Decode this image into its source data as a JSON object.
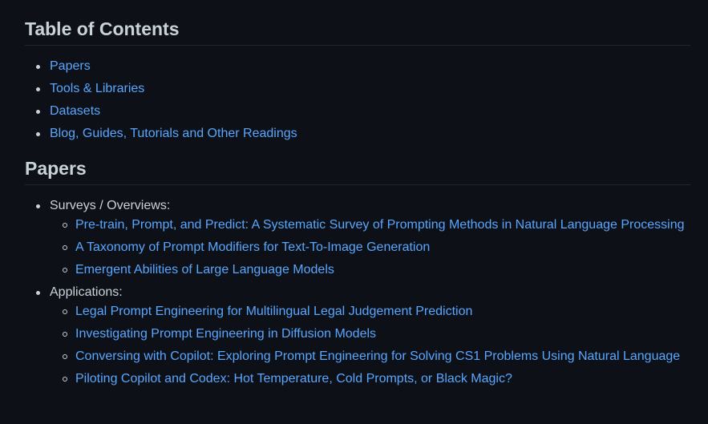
{
  "toc": {
    "heading": "Table of Contents",
    "items": [
      {
        "label": "Papers"
      },
      {
        "label": "Tools & Libraries"
      },
      {
        "label": "Datasets"
      },
      {
        "label": "Blog, Guides, Tutorials and Other Readings"
      }
    ]
  },
  "papers": {
    "heading": "Papers",
    "groups": [
      {
        "label": "Surveys / Overviews:",
        "items": [
          {
            "label": "Pre-train, Prompt, and Predict: A Systematic Survey of Prompting Methods in Natural Language Processing"
          },
          {
            "label": "A Taxonomy of Prompt Modifiers for Text-To-Image Generation"
          },
          {
            "label": "Emergent Abilities of Large Language Models"
          }
        ]
      },
      {
        "label": "Applications:",
        "items": [
          {
            "label": "Legal Prompt Engineering for Multilingual Legal Judgement Prediction"
          },
          {
            "label": "Investigating Prompt Engineering in Diffusion Models"
          },
          {
            "label": "Conversing with Copilot: Exploring Prompt Engineering for Solving CS1 Problems Using Natural Language"
          },
          {
            "label": "Piloting Copilot and Codex: Hot Temperature, Cold Prompts, or Black Magic?"
          }
        ]
      }
    ]
  },
  "colors": {
    "background": "#0d1117",
    "text": "#c9d1d9",
    "link": "#58a6ff",
    "divider": "#21262d"
  }
}
